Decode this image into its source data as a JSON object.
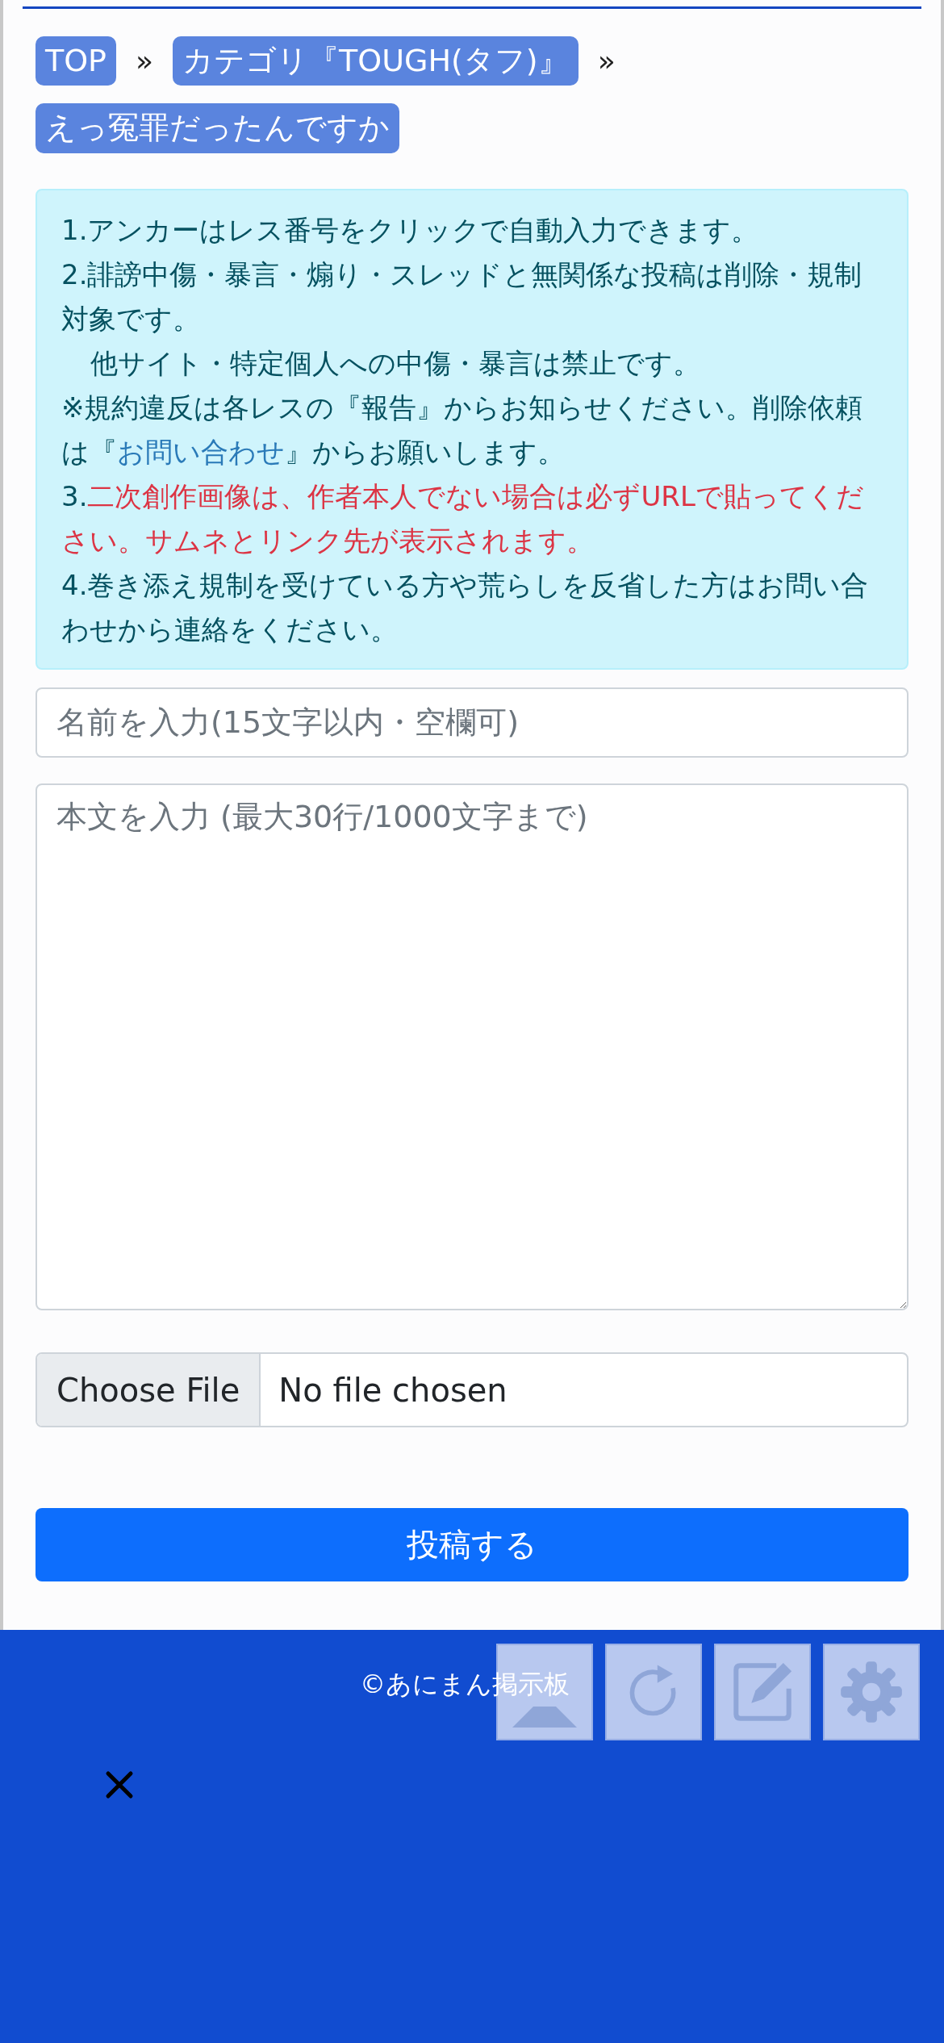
{
  "breadcrumb": [
    {
      "label": "TOP",
      "separator": "»"
    },
    {
      "label": "カテゴリ『TOUGH(タフ)』",
      "separator": "»"
    },
    {
      "label": "えっ冤罪だったんですか"
    }
  ],
  "notice": [
    {
      "indent": false,
      "segments": [
        {
          "kind": "plain",
          "text": "1.アンカーはレス番号をクリックで自動入力できます。"
        }
      ]
    },
    {
      "indent": false,
      "segments": [
        {
          "kind": "plain",
          "text": "2.誹謗中傷・暴言・煽り・スレッドと無関係な投稿は削除・規制対象です。"
        }
      ]
    },
    {
      "indent": true,
      "segments": [
        {
          "kind": "plain",
          "text": "他サイト・特定個人への中傷・暴言は禁止です。"
        }
      ]
    },
    {
      "indent": false,
      "segments": [
        {
          "kind": "plain",
          "text": "※規約違反は各レスの『報告』からお知らせください。削除依頼は『"
        },
        {
          "kind": "link",
          "text": "お問い合わせ"
        },
        {
          "kind": "plain",
          "text": "』からお願いします。"
        }
      ]
    },
    {
      "indent": false,
      "segments": [
        {
          "kind": "plain",
          "text": "3."
        },
        {
          "kind": "alert",
          "text": "二次創作画像は、作者本人でない場合は必ずURLで貼ってください。サムネとリンク先が表示されます。"
        }
      ]
    },
    {
      "indent": false,
      "segments": [
        {
          "kind": "plain",
          "text": "4.巻き添え規制を受けている方や荒らしを反省した方はお問い合わせから連絡をください。"
        }
      ]
    }
  ],
  "name_field": {
    "placeholder": "名前を入力(15文字以内・空欄可)"
  },
  "body_field": {
    "placeholder": "本文を入力 (最大30行/1000文字まで)"
  },
  "file_input": {
    "button": "Choose File",
    "status": "No file chosen"
  },
  "submit_button": "投稿する",
  "footer": {
    "copyright": "©あにまん掲示板"
  }
}
